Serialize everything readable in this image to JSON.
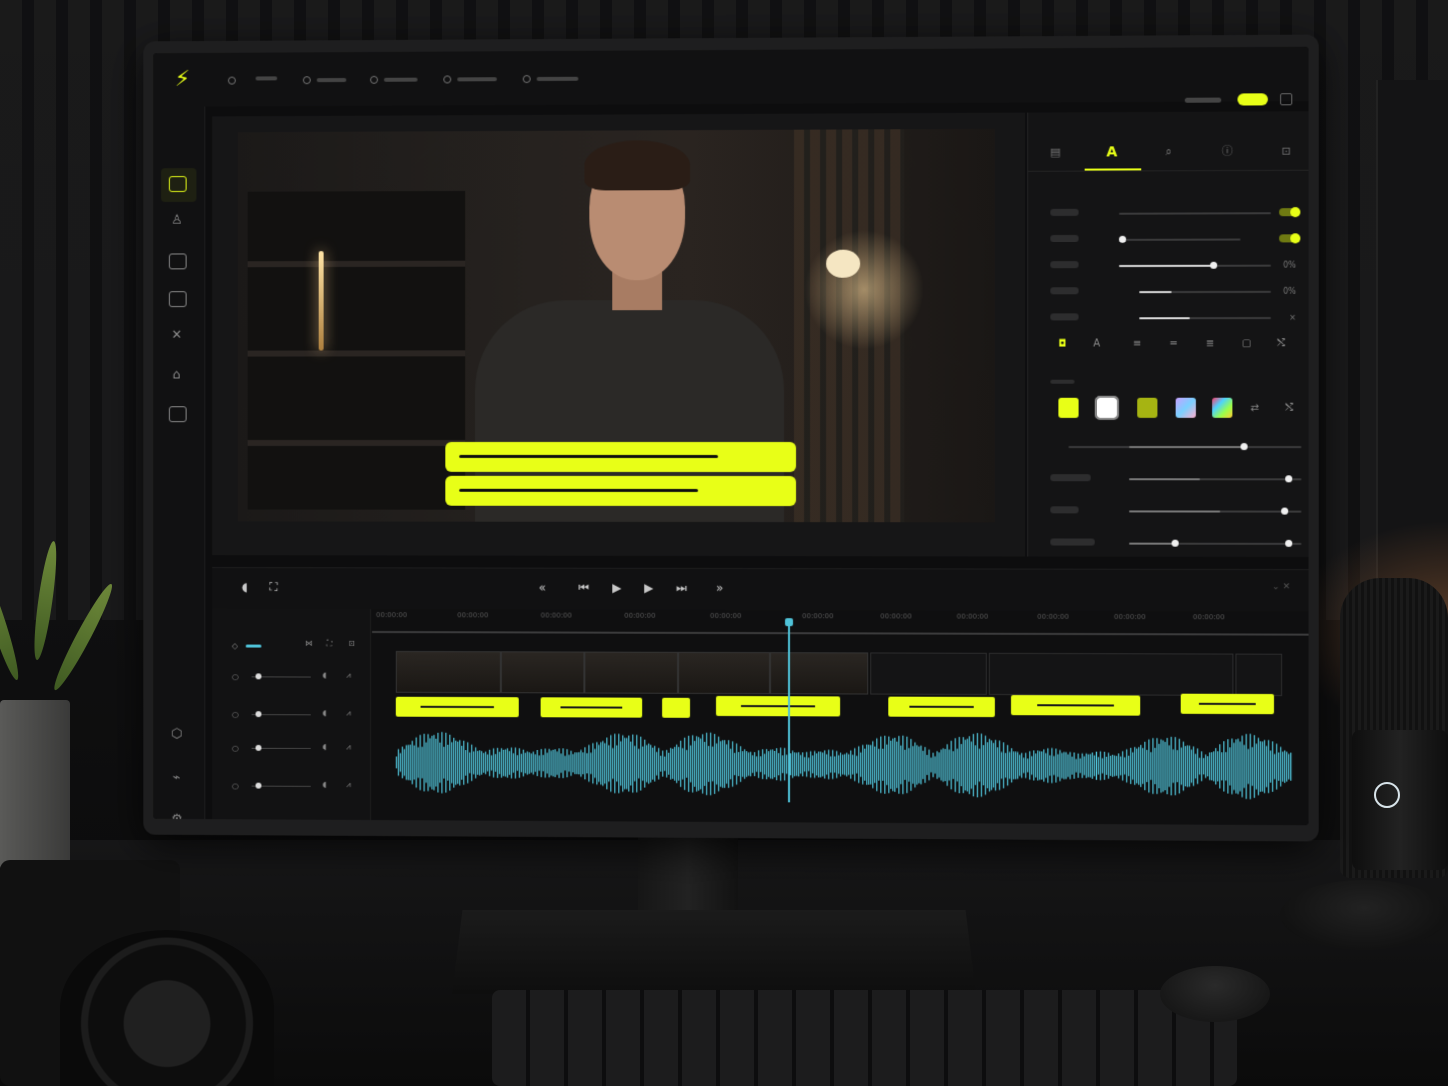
{
  "app": {
    "logo_icon": "bolt-icon",
    "accent": "#e8ff17",
    "wave_color": "#4fc3d9"
  },
  "topbar": {
    "menu_icons": [
      "home-icon",
      "menu-item-icon",
      "menu-item-icon",
      "menu-item-icon",
      "menu-item-icon"
    ],
    "right": {
      "expand_icon": "expand-icon"
    }
  },
  "sidebar": {
    "items": [
      {
        "name": "media-icon",
        "active": true
      },
      {
        "name": "person-icon"
      },
      {
        "name": "text-icon"
      },
      {
        "name": "import-icon"
      },
      {
        "name": "transitions-icon"
      },
      {
        "name": "effects-icon"
      },
      {
        "name": "export-icon"
      }
    ],
    "bottom": [
      "plugins-icon",
      "link-icon",
      "settings-icon",
      "undo-icon"
    ]
  },
  "panel": {
    "tabs": [
      {
        "name": "layout-tab-icon",
        "glyph": "▤"
      },
      {
        "name": "text-tab-icon",
        "glyph": "A",
        "active": true
      },
      {
        "name": "search-tab-icon",
        "glyph": "⌕"
      },
      {
        "name": "info-tab-icon",
        "glyph": "ⓘ"
      },
      {
        "name": "export-tab-icon",
        "glyph": "⊡"
      }
    ],
    "value_labels": [
      "0%",
      "0%"
    ],
    "align_icons": [
      {
        "name": "bold-icon",
        "glyph": "◘"
      },
      {
        "name": "font-icon",
        "glyph": "A"
      },
      {
        "name": "align-left-icon",
        "glyph": "≡"
      },
      {
        "name": "align-center-icon",
        "glyph": "="
      },
      {
        "name": "align-right-icon",
        "glyph": "≣"
      },
      {
        "name": "box-icon",
        "glyph": "▢"
      },
      {
        "name": "shuffle-icon",
        "glyph": "⤭"
      }
    ],
    "swatches": [
      "#e8ff17",
      "#ffffff",
      "#a6b412",
      "gradient-purple",
      "gradient-rainbow"
    ]
  },
  "transport": {
    "glyphs": {
      "rewind": "«",
      "prev": "⏮",
      "play": "▶",
      "step": "▶",
      "next": "⏭",
      "forward": "»",
      "volume": "🔈",
      "fullscreen": "⛶"
    }
  },
  "timeline": {
    "ruler_labels": [
      "00:00:00",
      "00:00:00",
      "00:00:00",
      "00:00:00",
      "00:00:00",
      "00:00:00",
      "00:00:00",
      "00:00:00",
      "00:00:00",
      "00:00:00",
      "00:00:00"
    ]
  }
}
